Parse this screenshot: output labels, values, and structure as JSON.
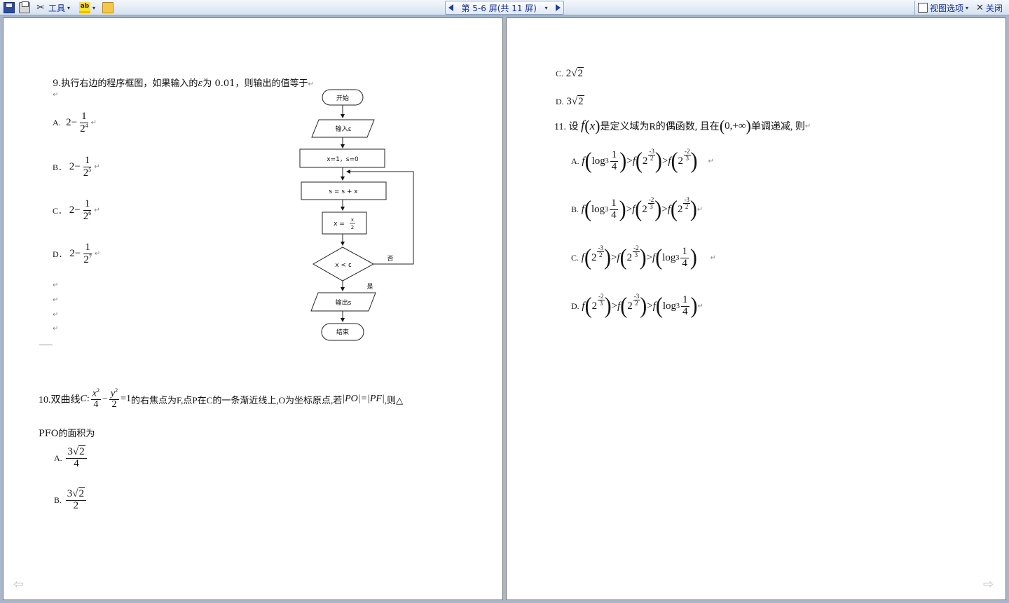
{
  "toolbar": {
    "tools_label": "工具",
    "pager_label": "第 5-6 屏(共 11 屏)",
    "view_options_label": "视图选项",
    "close_label": "关闭",
    "highlight_glyph": "ab"
  },
  "left_page": {
    "q9": {
      "text": "9.执行右边的程序框图，如果输入的",
      "epsilon": "ε",
      "text2": "为 0.01，则输出的值等于",
      "options": [
        {
          "label": "A.",
          "expr_lead": "2−",
          "num": "1",
          "base": "2",
          "exp": "4"
        },
        {
          "label": "B．",
          "expr_lead": "2−",
          "num": "1",
          "base": "2",
          "exp": "5"
        },
        {
          "label": "C．",
          "expr_lead": "2−",
          "num": "1",
          "base": "2",
          "exp": "6"
        },
        {
          "label": "D．",
          "expr_lead": "2−",
          "num": "1",
          "base": "2",
          "exp": "7"
        }
      ]
    },
    "flowchart": {
      "start": "开始",
      "input": "输入ε",
      "init": "x=1，s=0",
      "assign": "s = s + x",
      "update_lhs": "x =",
      "update_num": "x",
      "update_den": "2",
      "cond": "x < ε",
      "no": "否",
      "yes": "是",
      "output": "输出s",
      "end": "结束"
    },
    "q10": {
      "prefix": "10.双曲线",
      "curve": "C",
      "colon": ":",
      "x2": "x",
      "den1": "4",
      "minus": "−",
      "y2": "y",
      "den2": "2",
      "eq": "=1",
      "text": "的右焦点为F,点P在C的一条渐近线上,O为坐标原点,若",
      "abs": "|PO|=|PF|",
      "tail": ",则△",
      "line2": "PFO的面积为",
      "options": [
        {
          "label": "A.",
          "coef": "3",
          "rad": "2",
          "den": "4"
        },
        {
          "label": "B.",
          "coef": "3",
          "rad": "2",
          "den": "2"
        }
      ]
    }
  },
  "right_page": {
    "q9_rest": [
      {
        "label": "C.",
        "coef": "2",
        "rad": "2"
      },
      {
        "label": "D.",
        "coef": "3",
        "rad": "2"
      }
    ],
    "q11": {
      "prefix": "11. 设",
      "fx": "f",
      "x": "x",
      "text1": "是定义域为R的偶函数, 且在",
      "interval": "0,+∞",
      "text2": "单调递减, 则",
      "options": [
        {
          "label": "A.",
          "terms": [
            "log3 1/4",
            "2^(-3/2)",
            "2^(-2/3)"
          ]
        },
        {
          "label": "B.",
          "terms": [
            "log3 1/4",
            "2^(-2/3)",
            "2^(-3/2)"
          ]
        },
        {
          "label": "C.",
          "terms": [
            "2^(-3/2)",
            "2^(-2/3)",
            "log3 1/4"
          ]
        },
        {
          "label": "D.",
          "terms": [
            "2^(-2/3)",
            "2^(-3/2)",
            "log3 1/4"
          ]
        }
      ]
    }
  },
  "math": {
    "f": "f",
    "gt": ">",
    "log": "log",
    "three": "3",
    "one": "1",
    "four": "4",
    "two": "2",
    "minus": "-",
    "sqrt": "√"
  }
}
